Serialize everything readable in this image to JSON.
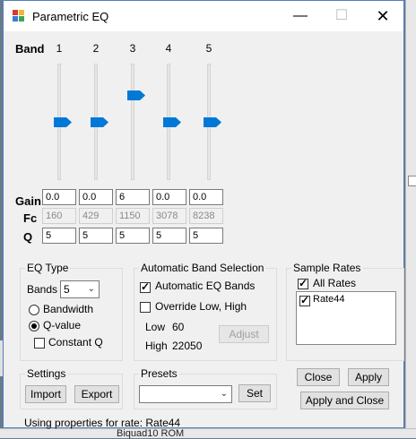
{
  "window": {
    "title": "Parametric EQ"
  },
  "titlebar": {
    "minimize": "—",
    "maximize": "☐",
    "close": "✕"
  },
  "bands": {
    "label": "Band",
    "numbers": [
      "1",
      "2",
      "3",
      "4",
      "5"
    ],
    "gain_label": "Gain",
    "fc_label": "Fc",
    "q_label": "Q",
    "gain": [
      "0.0",
      "0.0",
      "6",
      "0.0",
      "0.0"
    ],
    "fc": [
      "160",
      "429",
      "1150",
      "3078",
      "8238"
    ],
    "q": [
      "5",
      "5",
      "5",
      "5",
      "5"
    ],
    "slider_levels": [
      0.5,
      0.5,
      0.73,
      0.5,
      0.5
    ]
  },
  "eq_type": {
    "title": "EQ Type",
    "bands_label": "Bands",
    "bands_value": "5",
    "bandwidth": "Bandwidth",
    "qvalue": "Q-value",
    "constant_q": "Constant Q"
  },
  "auto_band": {
    "title": "Automatic Band Selection",
    "auto_eq": "Automatic EQ Bands",
    "override": "Override Low, High",
    "low_label": "Low",
    "low_value": "60",
    "high_label": "High",
    "high_value": "22050",
    "adjust": "Adjust"
  },
  "sample_rates": {
    "title": "Sample Rates",
    "all_rates": "All Rates",
    "items": [
      "Rate44"
    ]
  },
  "settings": {
    "title": "Settings",
    "import": "Import",
    "export": "Export"
  },
  "presets": {
    "title": "Presets",
    "value": "",
    "set": "Set"
  },
  "actions": {
    "close": "Close",
    "apply": "Apply",
    "apply_close": "Apply and Close"
  },
  "status": "Using properties for rate: Rate44",
  "background": {
    "bottom_text": "Biquad10 ROM"
  },
  "colors": {
    "accent": "#0078d7",
    "window_border": "#4f7fbf"
  }
}
